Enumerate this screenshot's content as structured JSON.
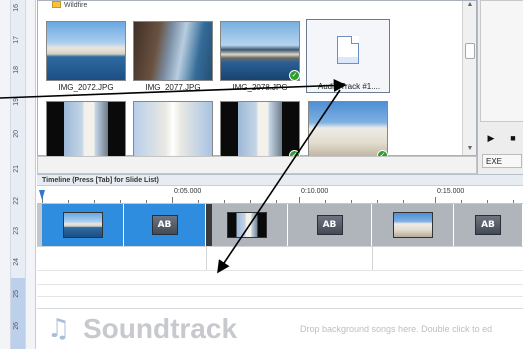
{
  "ruler_vertical": {
    "ticks": [
      "16",
      "17",
      "18",
      "19",
      "20",
      "21",
      "22",
      "23",
      "24",
      "25",
      "26"
    ]
  },
  "library": {
    "folder_label": "Wildfire",
    "items": [
      {
        "name": "IMG_2072.JPG",
        "type": "photo",
        "checked": false
      },
      {
        "name": "IMG_2077.JPG",
        "type": "photo",
        "checked": false
      },
      {
        "name": "IMG_2078.JPG",
        "type": "photo",
        "checked": true
      },
      {
        "name": "Audio Track #1....",
        "type": "audio",
        "checked": false
      },
      {
        "name": "",
        "type": "photo",
        "checked": false
      },
      {
        "name": "",
        "type": "photo",
        "checked": false
      },
      {
        "name": "",
        "type": "photo",
        "checked": true
      },
      {
        "name": "",
        "type": "photo",
        "checked": true
      }
    ]
  },
  "preview": {
    "play_icon": "play-icon",
    "stop_icon": "stop-icon",
    "exe_label": "EXE"
  },
  "timeline": {
    "header": "Timeline (Press [Tab] for Slide List)",
    "ruler_labels": [
      "0:05.000",
      "0:10.000",
      "0:15.000"
    ],
    "clips": [
      {
        "kind": "image",
        "color": "#2f8de0"
      },
      {
        "kind": "transition",
        "label": "AB",
        "color": "#2f8de0"
      },
      {
        "kind": "image",
        "color": "#b0b4bb"
      },
      {
        "kind": "transition",
        "label": "AB",
        "color": "#b0b4bb"
      },
      {
        "kind": "image",
        "color": "#b0b4bb"
      },
      {
        "kind": "transition",
        "label": "AB",
        "color": "#b0b4bb"
      }
    ]
  },
  "soundtrack": {
    "label": "Soundtrack",
    "hint": "Drop background songs here.  Double click to ed"
  },
  "colors": {
    "accent_blue": "#2f8de0",
    "clip_gray": "#b0b4bb",
    "check_green": "#2e9e2e"
  }
}
